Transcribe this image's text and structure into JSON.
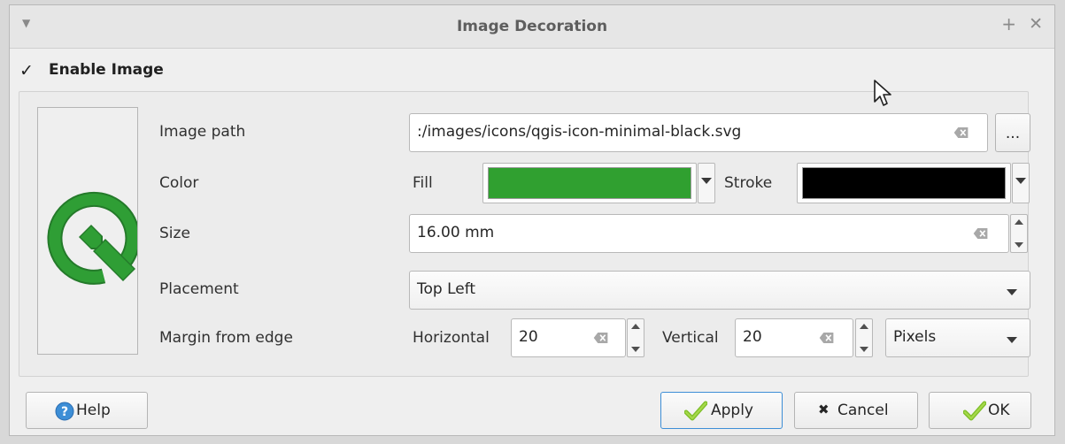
{
  "window": {
    "title": "Image Decoration"
  },
  "enable_image": {
    "label": "Enable Image",
    "checked": true
  },
  "labels": {
    "image_path": "Image path",
    "color": "Color",
    "size": "Size",
    "placement": "Placement",
    "margin": "Margin from edge"
  },
  "image_path": {
    "value": ":/images/icons/qgis-icon-minimal-black.svg",
    "browse_label": "..."
  },
  "color": {
    "fill_label": "Fill",
    "fill_color": "#30a030",
    "stroke_label": "Stroke",
    "stroke_color": "#000000"
  },
  "size": {
    "value": "16.00 mm"
  },
  "placement": {
    "value": "Top Left"
  },
  "margin": {
    "horizontal_label": "Horizontal",
    "horizontal_value": "20",
    "vertical_label": "Vertical",
    "vertical_value": "20",
    "unit": "Pixels"
  },
  "buttons": {
    "help": "Help",
    "apply": "Apply",
    "cancel": "Cancel",
    "ok": "OK"
  },
  "colors": {
    "logo_green": "#2f9e35",
    "accent_blue": "#3d8ed6"
  }
}
